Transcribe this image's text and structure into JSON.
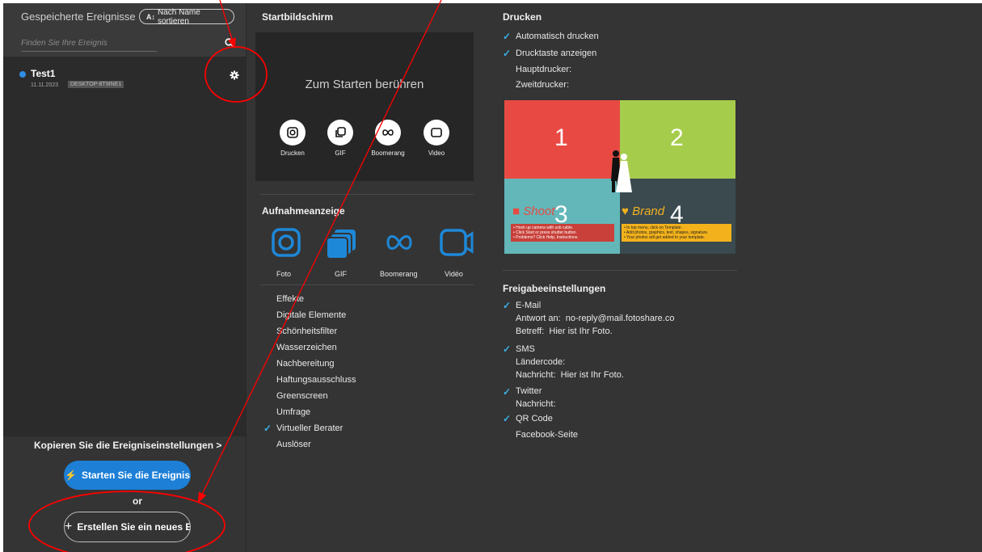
{
  "sidebar": {
    "title": "Gespeicherte Ereignisse",
    "sort_label": "Nach Name sortieren",
    "search_placeholder": "Finden Sie Ihre Ereignis",
    "events": [
      {
        "name": "Test1",
        "date": "11.11.2023",
        "device": "DESKTOP-8T9INE1"
      }
    ],
    "copy_settings": "Kopieren Sie die Ereigniseinstellungen >",
    "start_button": "Starten Sie die Ereignis",
    "or_label": "or",
    "new_button": "Erstellen Sie ein neues E"
  },
  "start_screen": {
    "title": "Startbildschirm",
    "touch_text": "Zum Starten berühren",
    "options": [
      "Drucken",
      "GIF",
      "Boomerang",
      "Video"
    ]
  },
  "capture": {
    "title": "Aufnahmeanzeige",
    "items": [
      "Foto",
      "GIF",
      "Boomerang",
      "Vidéo"
    ]
  },
  "menu": {
    "items": [
      "Effekte",
      "Digitale Elemente",
      "Schönheitsfilter",
      "Wasserzeichen",
      "Nachbereitung",
      "Haftungsausschluss",
      "Greenscreen",
      "Umfrage",
      "Virtueller Berater",
      "Auslöser"
    ],
    "checked": "Virtueller Berater"
  },
  "print": {
    "title": "Drucken",
    "auto_print": "Automatisch drucken",
    "show_button": "Drucktaste anzeigen",
    "main_printer": "Hauptdrucker:",
    "second_printer": "Zweitdrucker:"
  },
  "template": {
    "numbers": [
      "1",
      "2",
      "3",
      "4"
    ],
    "shoot_word": "Shoot",
    "brand_word": "Brand",
    "shoot_lines": [
      "• Hook up camera with usb cable.",
      "• Click Start or press shutter button.",
      "• Problems? Click Help, Instructions."
    ],
    "brand_lines": [
      "• In top menu, click on Template.",
      "• Add photos, graphics, text, shapes, signature.",
      "• Your photos will get added to your template."
    ]
  },
  "share": {
    "title": "Freigabeeinstellungen",
    "email": "E-Mail",
    "reply_label": "Antwort an:",
    "reply_value": "no-reply@mail.fotoshare.co",
    "subject_label": "Betreff:",
    "subject_value": "Hier ist Ihr Foto.",
    "sms": "SMS",
    "country_code": "Ländercode:",
    "message_label": "Nachricht:",
    "message_value": "Hier ist Ihr Foto.",
    "twitter": "Twitter",
    "twitter_message": "Nachricht:",
    "qr": "QR Code",
    "facebook": "Facebook-Seite"
  },
  "colors": {
    "accent": "#1d7fd6",
    "check": "#3ab0e8",
    "annotation": "#ff0000"
  }
}
